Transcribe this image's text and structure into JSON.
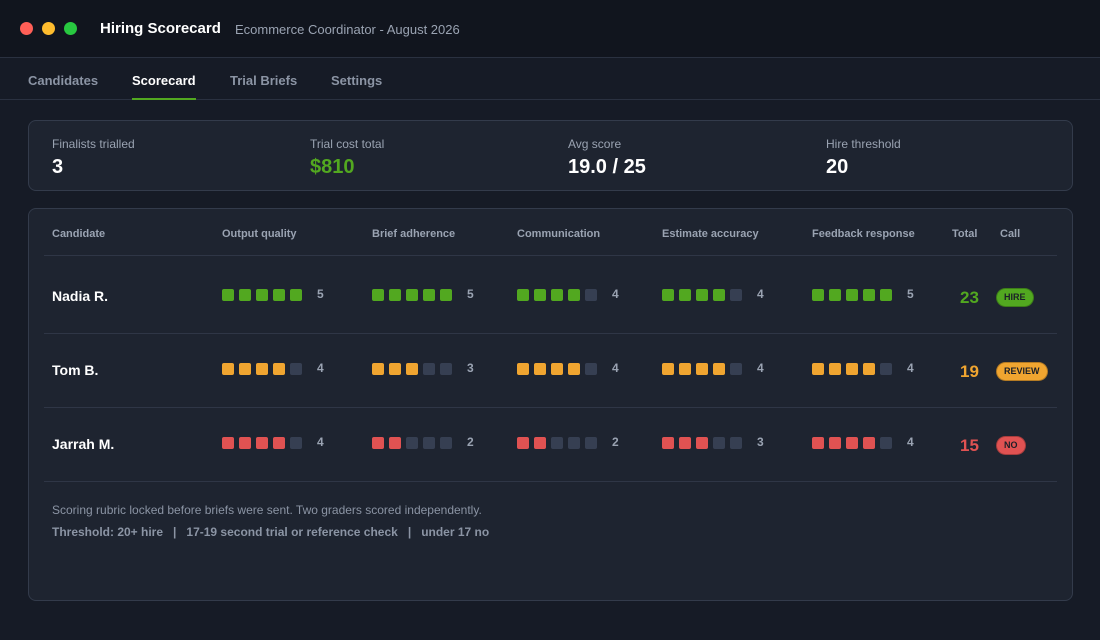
{
  "window": {
    "title": "Hiring Scorecard",
    "subtitle": "Ecommerce Coordinator - August 2026"
  },
  "tabs": [
    {
      "label": "Candidates",
      "active": false
    },
    {
      "label": "Scorecard",
      "active": true
    },
    {
      "label": "Trial Briefs",
      "active": false
    },
    {
      "label": "Settings",
      "active": false
    }
  ],
  "summary": [
    {
      "label": "Finalists trialled",
      "value": "3"
    },
    {
      "label": "Trial cost total",
      "value": "$810"
    },
    {
      "label": "Avg score",
      "value": "19.0 / 25"
    },
    {
      "label": "Hire threshold",
      "value": "20"
    }
  ],
  "table": {
    "headers": {
      "candidate": "Candidate",
      "criteria": [
        "Output quality",
        "Brief adherence",
        "Communication",
        "Estimate accuracy",
        "Feedback response"
      ],
      "total": "Total",
      "call": "Call"
    },
    "max_score": 5,
    "rows": [
      {
        "name": "Nadia R.",
        "scores": [
          5,
          5,
          4,
          4,
          5
        ],
        "total": "23",
        "call": "HIRE",
        "color": "#52a820"
      },
      {
        "name": "Tom B.",
        "scores": [
          4,
          3,
          4,
          4,
          4
        ],
        "total": "19",
        "call": "REVIEW",
        "color": "#f0a530"
      },
      {
        "name": "Jarrah M.",
        "scores": [
          4,
          2,
          2,
          3,
          4
        ],
        "total": "15",
        "call": "NO",
        "color": "#e05252"
      }
    ]
  },
  "notes": {
    "line1": "Scoring rubric locked before briefs were sent. Two graders scored independently.",
    "line2": "Threshold: 20+ hire   |   17-19 second trial or reference check   |   under 17 no"
  },
  "colors": {
    "accent": "#52a820",
    "empty_square": "#363f52",
    "background": "#161b26",
    "panel": "#1e2430"
  }
}
